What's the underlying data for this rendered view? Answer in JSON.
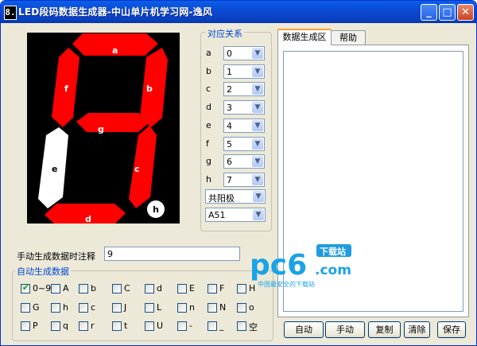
{
  "window": {
    "icon_glyph": "8.",
    "title": "LED段码数据生成器-中山单片机学习网-逸风",
    "controls": {
      "minimize": "_",
      "maximize": "□",
      "close": "✕"
    }
  },
  "display": {
    "segments": [
      {
        "id": "a",
        "label": "a",
        "lit": true
      },
      {
        "id": "b",
        "label": "b",
        "lit": true
      },
      {
        "id": "c",
        "label": "c",
        "lit": true
      },
      {
        "id": "d",
        "label": "d",
        "lit": true
      },
      {
        "id": "e",
        "label": "e",
        "lit": false
      },
      {
        "id": "f",
        "label": "f",
        "lit": true
      },
      {
        "id": "g",
        "label": "g",
        "lit": true
      },
      {
        "id": "h",
        "label": "h",
        "lit": false
      }
    ],
    "lit_color": "#ff0000",
    "unlit_color": "#ffffff"
  },
  "mapping": {
    "title": "对应关系",
    "rows": [
      {
        "label": "a",
        "value": "0"
      },
      {
        "label": "b",
        "value": "1"
      },
      {
        "label": "c",
        "value": "2"
      },
      {
        "label": "d",
        "value": "3"
      },
      {
        "label": "e",
        "value": "4"
      },
      {
        "label": "f",
        "value": "5"
      },
      {
        "label": "g",
        "value": "6"
      },
      {
        "label": "h",
        "value": "7"
      }
    ],
    "polarity": "共阳极",
    "compiler": "A51"
  },
  "tabs": [
    {
      "label": "数据生成区",
      "active": true
    },
    {
      "label": "帮助",
      "active": false
    }
  ],
  "output_text": "",
  "buttons": [
    "自动",
    "手动",
    "复制",
    "清除",
    "保存"
  ],
  "note": {
    "label": "手动生成数据时注释",
    "value": "9"
  },
  "auto": {
    "title": "自动生成数据",
    "rows": [
      [
        {
          "label": "0~9",
          "checked": true
        },
        {
          "label": "A",
          "checked": false
        },
        {
          "label": "b",
          "checked": false
        },
        {
          "label": "C",
          "checked": false
        },
        {
          "label": "d",
          "checked": false
        },
        {
          "label": "E",
          "checked": false
        },
        {
          "label": "F",
          "checked": false
        },
        {
          "label": "H",
          "checked": false
        }
      ],
      [
        {
          "label": "G",
          "checked": false
        },
        {
          "label": "h",
          "checked": false
        },
        {
          "label": "c",
          "checked": false
        },
        {
          "label": "J",
          "checked": false
        },
        {
          "label": "L",
          "checked": false
        },
        {
          "label": "n",
          "checked": false
        },
        {
          "label": "N",
          "checked": false
        },
        {
          "label": "o",
          "checked": false
        }
      ],
      [
        {
          "label": "P",
          "checked": false
        },
        {
          "label": "q",
          "checked": false
        },
        {
          "label": "r",
          "checked": false
        },
        {
          "label": "t",
          "checked": false
        },
        {
          "label": "U",
          "checked": false
        },
        {
          "label": "-",
          "checked": false
        },
        {
          "label": "_",
          "checked": false
        },
        {
          "label": "空",
          "checked": false
        }
      ]
    ]
  },
  "watermark": {
    "brand": "pc6",
    "domain": ".com",
    "badge": "下载站",
    "tagline": "中国最安全的下载站"
  }
}
